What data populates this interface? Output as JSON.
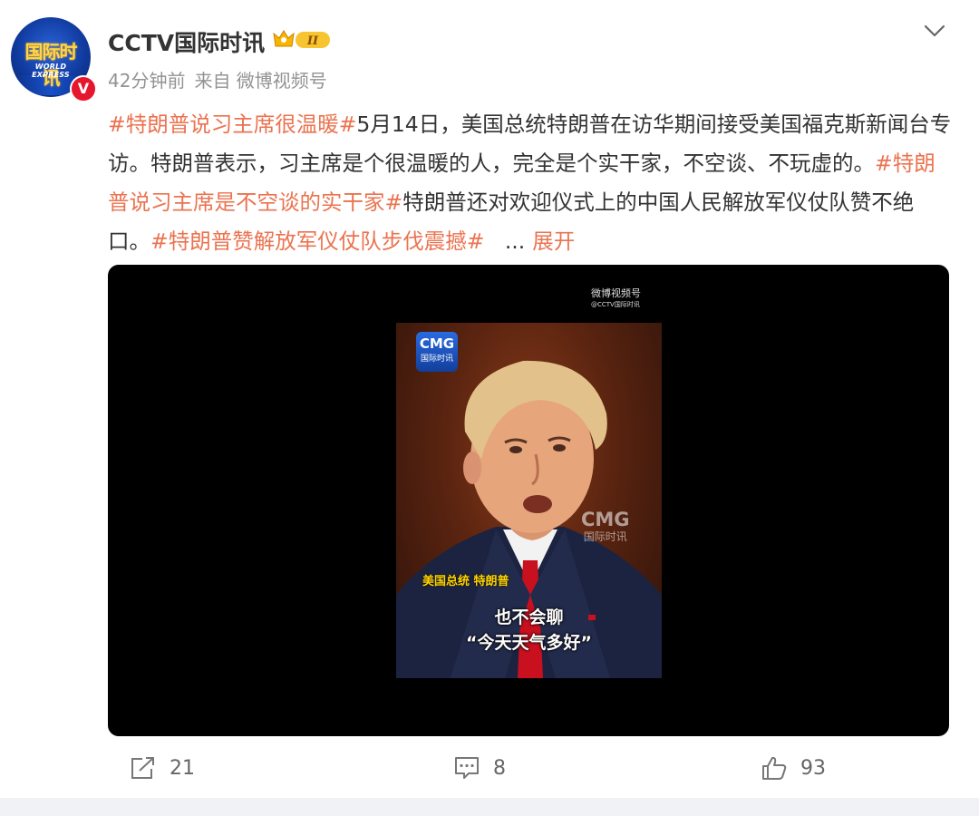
{
  "post": {
    "author": {
      "name": "CCTV国际时讯",
      "avatar_logo_cn": "国际时讯",
      "avatar_logo_en": "WORLD EXPRESS",
      "verified_mark": "V",
      "level_badge": "II"
    },
    "time": "42分钟前",
    "source": "来自 微博视频号",
    "text": {
      "tag1": "#特朗普说习主席很温暖#",
      "seg1": "5月14日，美国总统特朗普在访华期间接受美国福克斯新闻台专访。特朗普表示，习主席是个很温暖的人，完全是个实干家，不空谈、不玩虚的。",
      "tag2": "#特朗普说习主席是不空谈的实干家#",
      "seg2": "特朗普还对欢迎仪式上的中国人民解放军仪仗队赞不绝口。",
      "tag3": "#特朗普赞解放军仪仗队步伐震撼#",
      "ellipsis": "...",
      "expand": "展开"
    },
    "video": {
      "watermark_top_line1": "微博视频号",
      "watermark_top_line2": "@CCTV国际时讯",
      "cmg_logo_line1": "CMG",
      "cmg_logo_line2": "国际时讯",
      "cmg_watermark_line1": "CMG",
      "cmg_watermark_line2": "国际时讯",
      "caption_name": "美国总统 特朗普",
      "caption_line1": "也不会聊",
      "caption_line2": "“今天天气多好”"
    },
    "actions": {
      "repost_count": "21",
      "comment_count": "8",
      "like_count": "93"
    }
  },
  "colors": {
    "link": "#eb7350",
    "verified": "#e6162d",
    "meta": "#939393"
  }
}
